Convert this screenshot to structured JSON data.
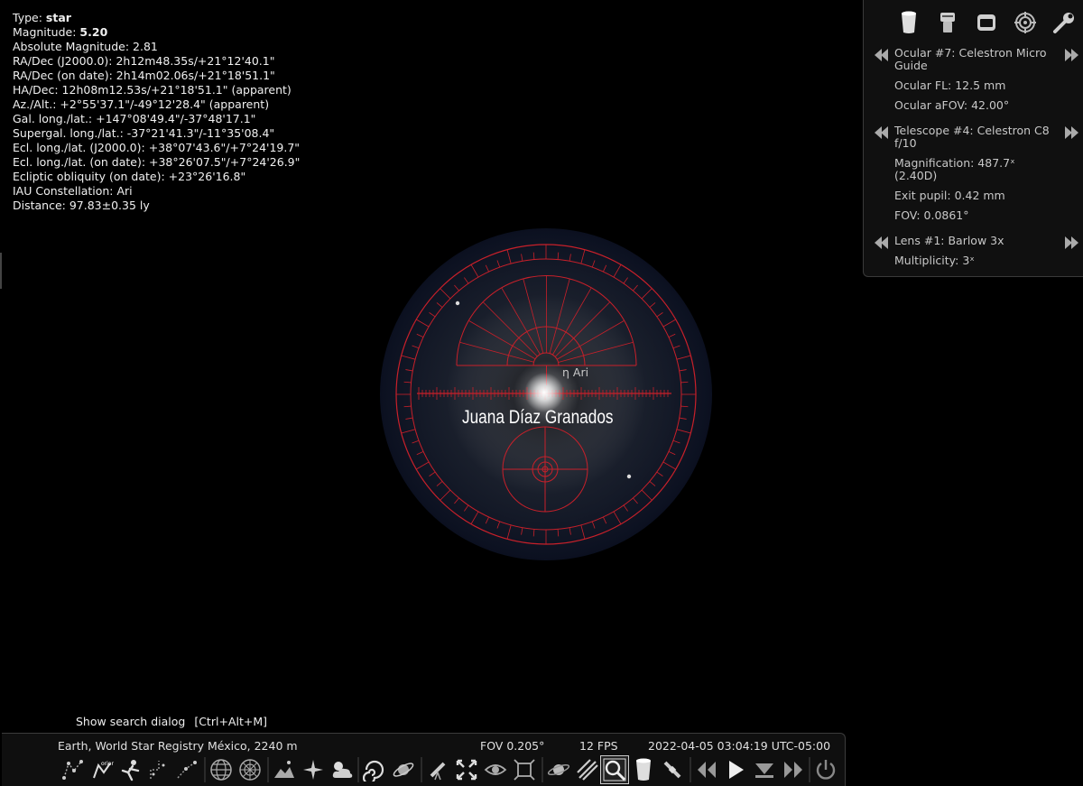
{
  "object_info": [
    {
      "label": "Type: ",
      "value": "star",
      "bold": true
    },
    {
      "label": "Magnitude: ",
      "value": "5.20",
      "bold": true
    },
    {
      "label": "Absolute Magnitude: 2.81"
    },
    {
      "label": "RA/Dec (J2000.0): 2h12m48.35s/+21°12'40.1\""
    },
    {
      "label": "RA/Dec (on date): 2h14m02.06s/+21°18'51.1\""
    },
    {
      "label": "HA/Dec: 12h08m12.53s/+21°18'51.1\" (apparent)"
    },
    {
      "label": "Az./Alt.: +2°55'37.1\"/-49°12'28.4\" (apparent)"
    },
    {
      "label": "Gal. long./lat.: +147°08'49.4\"/-37°48'17.1\""
    },
    {
      "label": "Supergal. long./lat.: -37°21'41.3\"/-11°35'08.4\""
    },
    {
      "label": "Ecl. long./lat. (J2000.0): +38°07'43.6\"/+7°24'19.7\""
    },
    {
      "label": "Ecl. long./lat. (on date): +38°26'07.5\"/+7°24'26.9\""
    },
    {
      "label": "Ecliptic obliquity (on date): +23°26'16.8\""
    },
    {
      "label": "IAU Constellation: Ari"
    },
    {
      "label": "Distance: 97.83±0.35 ly"
    }
  ],
  "ocular_panel": {
    "ocular_title": "Ocular #7: Celestron Micro Guide",
    "ocular_fl": "Ocular FL: 12.5 mm",
    "ocular_afov": "Ocular aFOV: 42.00°",
    "telescope_title": "Telescope #4: Celestron C8 f/10",
    "magnification": "Magnification: 487.7ˣ (2.40D)",
    "exit_pupil": "Exit pupil: 0.42 mm",
    "fov": "FOV: 0.0861°",
    "lens_title": "Lens #1: Barlow 3x",
    "multiplicity": "Multiplicity: 3ˣ"
  },
  "sky": {
    "star_label": "η Ari",
    "custom_label": "Juana Díaz Granados"
  },
  "tooltip": {
    "text": "Show search dialog",
    "shortcut": "[Ctrl+Alt+M]"
  },
  "status_bar": {
    "location": "Earth, World Star Registry México, 2240 m",
    "fov": "FOV 0.205°",
    "fps": "12 FPS",
    "datetime": "2022-04-05 03:04:19 UTC-05:00"
  },
  "colors": {
    "reticle": "#c8202a",
    "background": "#000000",
    "panel": "#101010"
  }
}
